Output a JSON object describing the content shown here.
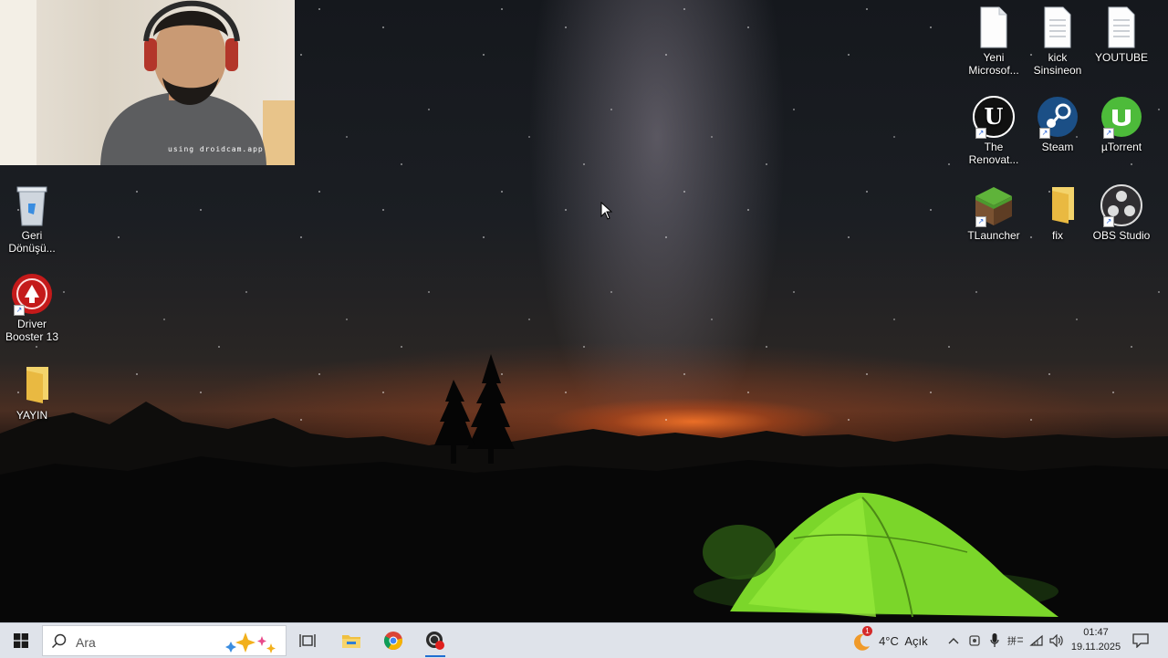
{
  "webcam": {
    "watermark": "using droidcam.app"
  },
  "desktop_icons": {
    "left": [
      {
        "name": "recycle-bin",
        "label_line1": "Geri",
        "label_line2": "Dönüşü..."
      },
      {
        "name": "driver-booster",
        "label_line1": "Driver",
        "label_line2": "Booster 13"
      },
      {
        "name": "yayin-folder",
        "label_line1": "YAYIN",
        "label_line2": ""
      }
    ],
    "right": [
      {
        "name": "yeni-microsoft",
        "label_line1": "Yeni",
        "label_line2": "Microsof..."
      },
      {
        "name": "kick-sinsineon",
        "label_line1": "kick",
        "label_line2": "Sinsineon"
      },
      {
        "name": "youtube-file",
        "label_line1": "YOUTUBE",
        "label_line2": ""
      },
      {
        "name": "the-renovator",
        "label_line1": "The",
        "label_line2": "Renovat..."
      },
      {
        "name": "steam",
        "label_line1": "Steam",
        "label_line2": ""
      },
      {
        "name": "utorrent",
        "label_line1": "µTorrent",
        "label_line2": ""
      },
      {
        "name": "tlauncher",
        "label_line1": "TLauncher",
        "label_line2": ""
      },
      {
        "name": "fix-folder",
        "label_line1": "fix",
        "label_line2": ""
      },
      {
        "name": "obs-studio",
        "label_line1": "OBS Studio",
        "label_line2": ""
      }
    ]
  },
  "taskbar": {
    "search_placeholder": "Ara",
    "apps": [
      "task-view",
      "file-explorer",
      "chrome",
      "app-record"
    ],
    "weather": {
      "temp": "4°C",
      "condition": "Açık",
      "badge": "1"
    },
    "clock": {
      "time": "01:47",
      "date": "19.11.2025"
    }
  },
  "colors": {
    "taskbar_bg": "#dfe3ea",
    "accent": "#1f6fd1"
  }
}
